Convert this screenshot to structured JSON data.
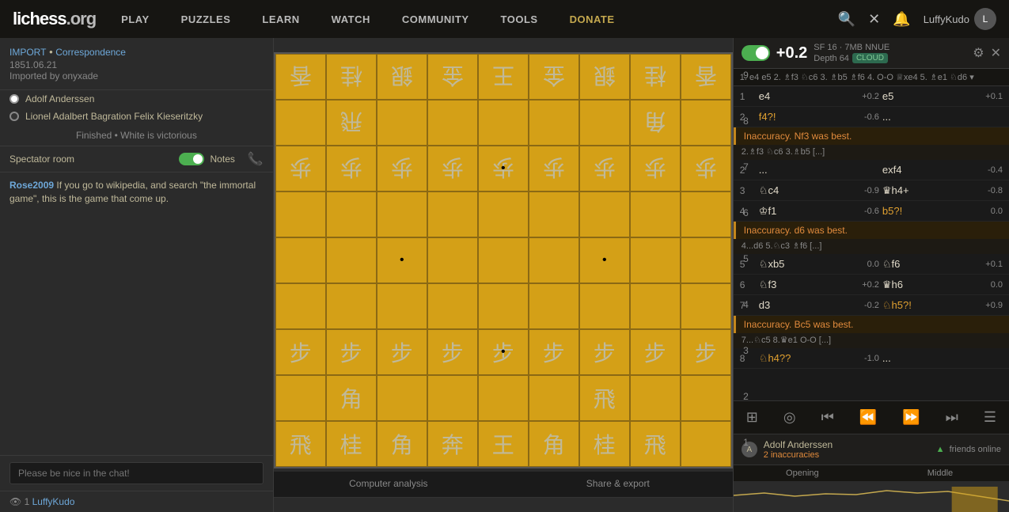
{
  "header": {
    "logo": "lichess.org",
    "nav": [
      {
        "label": "PLAY",
        "id": "play"
      },
      {
        "label": "PUZZLES",
        "id": "puzzles"
      },
      {
        "label": "LEARN",
        "id": "learn"
      },
      {
        "label": "WATCH",
        "id": "watch"
      },
      {
        "label": "COMMUNITY",
        "id": "community"
      },
      {
        "label": "TOOLS",
        "id": "tools"
      },
      {
        "label": "DONATE",
        "id": "donate",
        "special": true
      }
    ],
    "username": "LuffyKudo"
  },
  "game": {
    "import_label": "IMPORT",
    "type_label": "Correspondence",
    "date": "1851.06.21",
    "imported_by": "Imported by onyxade",
    "white_player": "Adolf Anderssen",
    "black_player": "Lionel Adalbert Bagration Felix Kieseritzky",
    "result": "Finished • White is victorious"
  },
  "spectator": {
    "label": "Spectator room",
    "notes_label": "Notes"
  },
  "chat": {
    "user": "Rose2009",
    "message": "If you go to wikipedia, and search \"the immortal game\", this is the game that come up.",
    "placeholder": "Please be nice in the chat!"
  },
  "watchers": {
    "count": "1",
    "name": "LuffyKudo"
  },
  "engine": {
    "eval": "+0.2",
    "sf_info": "SF 16 · 7MB  NNUE",
    "depth": "Depth 64",
    "cloud_label": "CLOUD",
    "toggle_state": true
  },
  "moves_breadcrumb": "1. e4 e5 2. ♗f3 ♘c6 3. ♗b5 ♗f6 4. O-O ♕xe4 5. ♗e1 ♘d6 ▾",
  "moves": [
    {
      "num": "1",
      "white": "e4",
      "white_eval": "+0.2",
      "black": "e5",
      "black_eval": "+0.1"
    },
    {
      "num": "2",
      "white": "f4?!",
      "white_eval": "-0.6",
      "black": "...",
      "black_eval": ""
    },
    {
      "num": null,
      "inaccuracy": "Inaccuracy. Nf3 was best.",
      "continuation": "2.♗f3 ♘c6 3.♗b5 [...]"
    },
    {
      "num": "2",
      "white": "...",
      "white_eval": "",
      "black": "exf4",
      "black_eval": "-0.4"
    },
    {
      "num": "3",
      "white": "♘c4",
      "white_eval": "-0.9",
      "black": "♛h4+",
      "black_eval": "-0.8"
    },
    {
      "num": "4",
      "white": "♔f1",
      "white_eval": "-0.6",
      "black": "b5?!",
      "black_eval": "0.0"
    },
    {
      "num": null,
      "inaccuracy": "Inaccuracy. d6 was best.",
      "continuation": "4...d6 5.♘c3 ♗f6 [...]"
    },
    {
      "num": "5",
      "white": "♘xb5",
      "white_eval": "0.0",
      "black": "♘f6",
      "black_eval": "+0.1"
    },
    {
      "num": "6",
      "white": "♘f3",
      "white_eval": "+0.2",
      "black": "♛h6",
      "black_eval": "0.0"
    },
    {
      "num": "7",
      "white": "d3",
      "white_eval": "-0.2",
      "black": "♘h5?!",
      "black_eval": "+0.9"
    },
    {
      "num": null,
      "inaccuracy": "Inaccuracy. Bc5 was best.",
      "continuation": "7...♘c5 8.♛e1 O-O [...]"
    },
    {
      "num": "8",
      "white": "♘h4??",
      "white_eval": "-1.0",
      "black": "...",
      "black_eval": ""
    }
  ],
  "bottom_controls": {
    "icons": [
      "⊞",
      "◎",
      "⏮",
      "⏪",
      "⏩",
      "⏭",
      "☰"
    ]
  },
  "analysis_tabs": [
    {
      "label": "Computer analysis",
      "active": false
    },
    {
      "label": "Share & export",
      "active": false
    }
  ],
  "chart_tabs": [
    {
      "label": "Opening",
      "active": false
    },
    {
      "label": "Middle",
      "active": false
    }
  ],
  "players_bottom": {
    "white_name": "Adolf Anderssen",
    "white_inaccuracies": "2 inaccuracies",
    "friends_label": "friends online"
  }
}
